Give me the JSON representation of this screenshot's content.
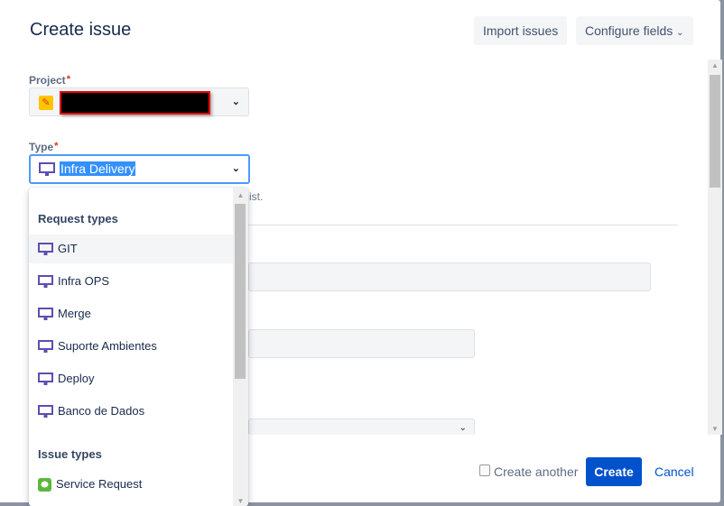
{
  "dialog": {
    "title": "Create issue",
    "import_label": "Import issues",
    "configure_label": "Configure fields"
  },
  "form": {
    "project_label": "Project",
    "required_mark": "*",
    "type_label": "Type",
    "type_value": "Infra Delivery",
    "type_hint_fragment": "ist."
  },
  "dropdown": {
    "groups": [
      {
        "label": "Request types",
        "items": [
          "GIT",
          "Infra OPS",
          "Merge",
          "Suporte Ambientes",
          "Deploy",
          "Banco de Dados"
        ],
        "icon": "monitor-icon",
        "icon_color": "#5e4db2"
      },
      {
        "label": "Issue types",
        "items": [
          "Service Request"
        ],
        "icon": "service-request-icon",
        "icon_color": "#5bb83c"
      }
    ],
    "highlighted": "GIT"
  },
  "footer": {
    "create_another_label": "Create another",
    "create_another_checked": false,
    "create_label": "Create",
    "cancel_label": "Cancel"
  },
  "colors": {
    "primary": "#0052cc",
    "focus": "#4c9aff",
    "required": "#de350b"
  }
}
